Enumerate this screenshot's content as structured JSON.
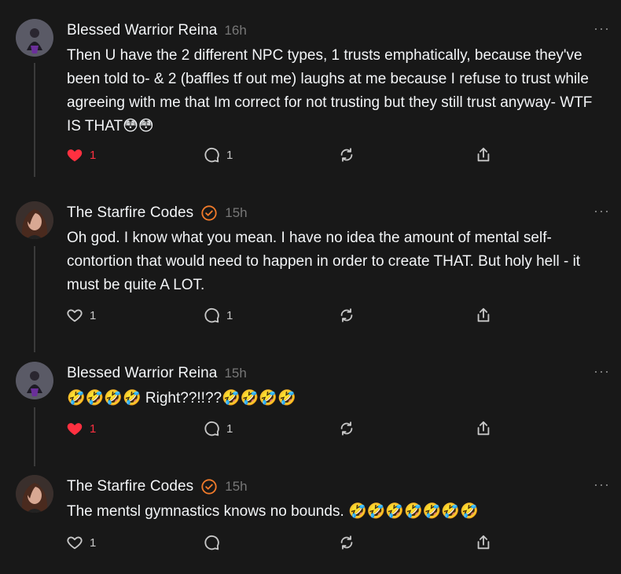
{
  "posts": [
    {
      "author": "Blessed Warrior Reina",
      "time": "16h",
      "verified": false,
      "text": "Then U have the 2 different NPC types, 1 trusts emphatically, because they've been told to- & 2 (baffles tf out me) laughs at me because I refuse to trust while agreeing with me that Im correct for not trusting but they still trust anyway- WTF IS THAT😳😳",
      "liked": true,
      "likes": "1",
      "replies": "1",
      "more": "···"
    },
    {
      "author": "The Starfire Codes",
      "time": "15h",
      "verified": true,
      "text": "Oh god. I know what you mean. I have no idea the amount of mental self-contortion that would need to happen in order to create THAT. But holy hell - it must be quite A LOT.",
      "liked": false,
      "likes": "1",
      "replies": "1",
      "more": "···"
    },
    {
      "author": "Blessed Warrior Reina",
      "time": "15h",
      "verified": false,
      "text": "🤣🤣🤣🤣 Right??!!??🤣🤣🤣🤣",
      "liked": true,
      "likes": "1",
      "replies": "1",
      "more": "···"
    },
    {
      "author": "The Starfire Codes",
      "time": "15h",
      "verified": true,
      "text": "The mentsl gymnastics knows no bounds. 🤣🤣🤣🤣🤣🤣🤣",
      "liked": false,
      "likes": "1",
      "replies": "",
      "more": "···"
    }
  ],
  "colors": {
    "background": "#181818",
    "text": "#f3f5f7",
    "muted": "#777777",
    "like_active": "#ff3040",
    "verified": "#f07a2a",
    "thread_line": "#3a3a3a"
  },
  "icons": [
    "heart-icon",
    "comment-icon",
    "repost-icon",
    "share-icon",
    "verified-icon",
    "more-icon"
  ]
}
